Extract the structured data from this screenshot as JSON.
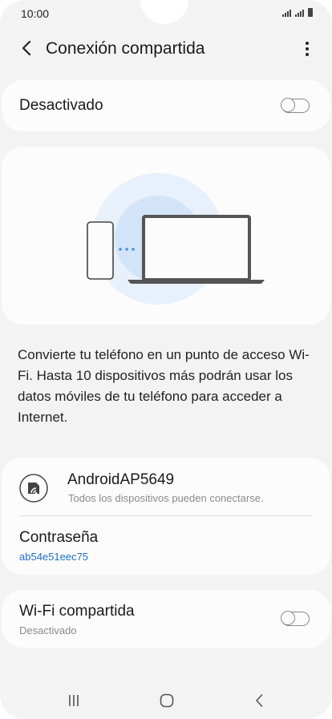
{
  "status": {
    "time": "10:00"
  },
  "appbar": {
    "title": "Conexión compartida"
  },
  "main_toggle": {
    "label": "Desactivado",
    "on": false
  },
  "description": "Convierte tu teléfono en un punto de acceso Wi-Fi. Hasta 10 dispositivos más podrán usar los datos móviles de tu teléfono para acceder a Internet.",
  "network": {
    "name": "AndroidAP5649",
    "subtitle": "Todos los dispositivos pueden conectarse.",
    "password_label": "Contraseña",
    "password_value": "ab54e51eec75"
  },
  "wifi_share": {
    "label": "Wi-Fi compartida",
    "status": "Desactivado",
    "on": false
  },
  "icons": {
    "back": "chevron-left-icon",
    "more": "more-vertical-icon",
    "hotspot": "hotspot-icon",
    "nav_recents": "recents-icon",
    "nav_home": "home-icon",
    "nav_back": "nav-back-icon"
  },
  "colors": {
    "accent": "#1d6fd1",
    "background": "#f3f3f3",
    "card": "#fcfcfc"
  }
}
